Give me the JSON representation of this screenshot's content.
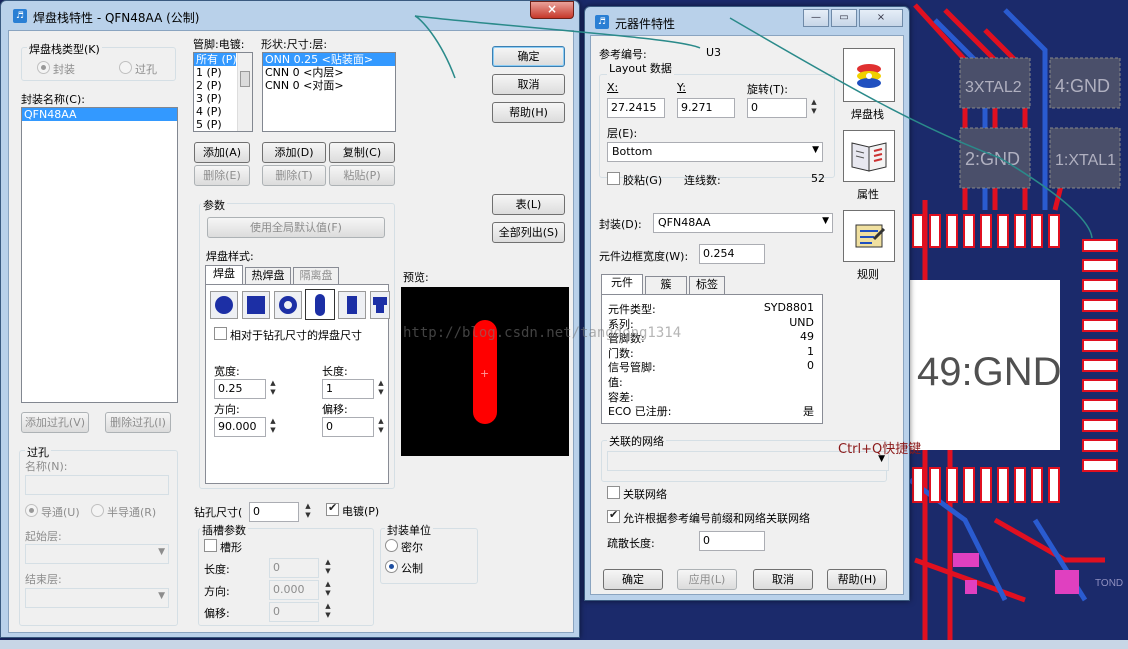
{
  "watermark": "http://blog.csdn.net/tangdong1314",
  "annotation": "Ctrl+Q快捷键",
  "pcb": {
    "labels": [
      "3XTAL2",
      "4:GND",
      "2:GND",
      "1:XTAL1",
      "49:GND",
      "TOND"
    ],
    "colors": {
      "bg": "#1b2a6b",
      "red": "#e01020",
      "pad": "#ffffff",
      "magenta": "#e040c0"
    }
  },
  "padstack": {
    "title": "焊盘栈特性 - QFN48AA (公制)",
    "close": "×",
    "type_group": "焊盘栈类型(K)",
    "radio_footprint": "封装",
    "radio_via": "过孔",
    "footprint_name_label": "封装名称(C):",
    "footprint_list": [
      "QFN48AA"
    ],
    "add_via": "添加过孔(V)",
    "delete_via": "删除过孔(I)",
    "via_group": "过孔",
    "via_name_label": "名称(N):",
    "via_through": "导通(U)",
    "via_semi": "半导通(R)",
    "start_layer": "起始层:",
    "end_layer": "结束层:",
    "pins_header": "管脚:电镀:",
    "pins": [
      "所有 (P)",
      "1 (P)",
      "2 (P)",
      "3 (P)",
      "4 (P)",
      "5 (P)"
    ],
    "shape_header": "形状:尺寸:层:",
    "shapes": [
      "ONN 0.25 <贴装面>",
      "CNN 0 <内层>",
      "CNN 0 <对面>"
    ],
    "add_pin": "添加(A)",
    "add_shape": "添加(D)",
    "copy": "复制(C)",
    "delete_pin": "删除(E)",
    "delete_shape": "删除(T)",
    "paste": "粘贴(P)",
    "ok": "确定",
    "cancel": "取消",
    "help": "帮助(H)",
    "table": "表(L)",
    "list_all": "全部列出(S)",
    "params_group": "参数",
    "use_global": "使用全局默认值(F)",
    "pad_style": "焊盘样式:",
    "tabs": [
      "焊盘",
      "热焊盘",
      "隔离盘"
    ],
    "shape_icons": [
      "circle-pad-icon",
      "square-pad-icon",
      "annular-pad-icon",
      "oval-pad-icon",
      "rectangle-pad-icon",
      "custom-pad-icon"
    ],
    "relative_drill": "相对于钻孔尺寸的焊盘尺寸",
    "width_label": "宽度:",
    "width_value": "0.25",
    "length_label": "长度:",
    "length_value": "1",
    "orient_label": "方向:",
    "orient_value": "90.000",
    "offset_label": "偏移:",
    "offset_value": "0",
    "preview_label": "预览:",
    "drill_label": "钻孔尺寸(",
    "drill_value": "0",
    "plated": "电镀(P)",
    "slot_group": "插槽参数",
    "slotted": "槽形",
    "slot_length_label": "长度:",
    "slot_length": "0",
    "slot_orient_label": "方向:",
    "slot_orient": "0.000",
    "slot_offset_label": "偏移:",
    "slot_offset": "0",
    "units_group": "封装单位",
    "unit_mil": "密尔",
    "unit_metric": "公制"
  },
  "component": {
    "title": "元器件特性",
    "ref_label": "参考编号:",
    "ref_value": "U3",
    "layout_group": "Layout 数据",
    "x_label": "X:",
    "x_value": "27.2415",
    "y_label": "Y:",
    "y_value": "9.271",
    "rot_label": "旋转(T):",
    "rot_value": "0",
    "layer_label": "层(E):",
    "layer_value": "Bottom",
    "glued": "胶粘(G)",
    "connections_label": "连线数:",
    "connections_value": "52",
    "footprint_label": "封装(D):",
    "footprint_value": "QFN48AA",
    "outline_label": "元件边框宽度(W):",
    "outline_value": "0.254",
    "side_buttons": [
      "焊盘栈",
      "属性",
      "规则"
    ],
    "tabs": [
      "元件",
      "簇",
      "标签"
    ],
    "info_rows": [
      {
        "k": "元件类型:",
        "v": "SYD8801"
      },
      {
        "k": "系列:",
        "v": "UND"
      },
      {
        "k": "管脚数:",
        "v": "49"
      },
      {
        "k": "门数:",
        "v": "1"
      },
      {
        "k": "信号管脚:",
        "v": "0"
      },
      {
        "k": "值:",
        "v": ""
      },
      {
        "k": "容差:",
        "v": ""
      },
      {
        "k": "ECO 已注册:",
        "v": "是"
      }
    ],
    "net_group": "关联的网络",
    "assoc_net": "关联网络",
    "allow_assoc": "允许根据参考编号前缀和网络关联网络",
    "fanout_label": "疏散长度:",
    "fanout_value": "0",
    "ok": "确定",
    "apply": "应用(L)",
    "cancel": "取消",
    "help": "帮助(H)"
  }
}
